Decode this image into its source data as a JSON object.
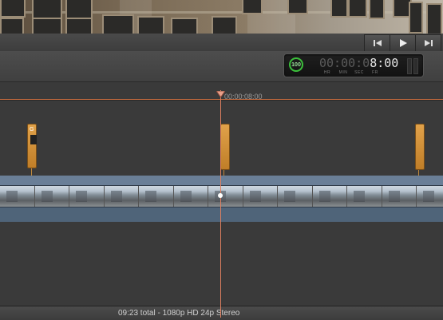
{
  "viewer": {
    "description_icon": "video-preview-image"
  },
  "transport": {
    "buttons": [
      {
        "name": "go-to-beginning",
        "icon": "skip-back-icon"
      },
      {
        "name": "play",
        "icon": "play-icon"
      },
      {
        "name": "go-to-end",
        "icon": "skip-forward-icon"
      }
    ]
  },
  "dashboard": {
    "audio_level": "100",
    "timecode_dim": "00:00:0",
    "timecode_bright": "8:00",
    "units": [
      "HR",
      "MIN",
      "SEC",
      "FR"
    ]
  },
  "timeline": {
    "playhead_time": "00:00:08:00",
    "marker_label": "G"
  },
  "status": {
    "text": "09:23 total - 1080p HD 24p Stereo"
  },
  "colors": {
    "accent": "#e08060",
    "marker": "#d8923a",
    "track": "#5a6f86"
  }
}
